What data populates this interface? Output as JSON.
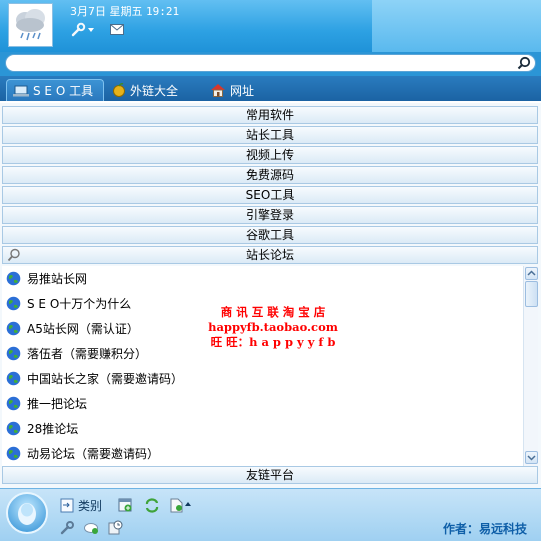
{
  "header": {
    "date": "3月7日",
    "weekday": "星期五",
    "time": "19:21"
  },
  "tabs": [
    {
      "label": "S E O 工具",
      "icon": "laptop-icon"
    },
    {
      "label": "外链大全",
      "icon": "fruit-icon"
    },
    {
      "label": "网址",
      "icon": "home-icon"
    }
  ],
  "categories": [
    "常用软件",
    "站长工具",
    "视频上传",
    "免费源码",
    "SEO工具",
    "引擎登录",
    "谷歌工具",
    "站长论坛"
  ],
  "forums": [
    "易推站长网",
    "S E O十万个为什么",
    "A5站长网（需认证）",
    "落伍者（需要赚积分）",
    "中国站长之家（需要邀请码）",
    "推一把论坛",
    "28推论坛",
    "动易论坛（需要邀请码）"
  ],
  "last_category": "友链平台",
  "promo": {
    "line1": "商 讯 互 联 淘 宝 店",
    "line2": "happyfb.taobao.com",
    "line3": "旺 旺：h a p p y y f b"
  },
  "bottom": {
    "category_label": "类别",
    "author": "作者：易远科技"
  },
  "colors": {
    "accent": "#2da1e3",
    "promo": "#ff0000"
  }
}
